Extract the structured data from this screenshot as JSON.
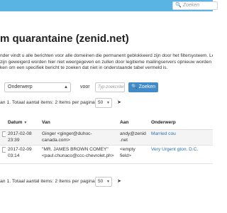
{
  "header": {
    "search_placeholder": "Zoeken",
    "search_icon": "search-icon"
  },
  "title": "m quarantaine (zenid.net)",
  "description": [
    "nder vindt u alle berichten voor alle domeinen die permanent geblokkeerd zijn door het filtersysteem. Let o",
    "zijn geweigerd worden hier niet weergegeven en zullen door legitieme mailingservers opnieuw worden aa",
    "ken om een specifiek bericht te zoeken dat niet in onderstaande tabel vermeld is."
  ],
  "filter": {
    "field_value": "Onderwerp",
    "voor_label": "voor",
    "search_placeholder": "Typ zoekcriteria in en",
    "search_button": "Zoeken"
  },
  "pagination": {
    "top_text": "an 1. Totaal aantal items: 2  Items per pagina:",
    "bottom_text": "an 1. Totaal aantal items: 2  Items per pagina:",
    "per_page": "50"
  },
  "table": {
    "columns": [
      "",
      "Datum",
      "Van",
      "Aan",
      "Onderwerp"
    ],
    "rows": [
      {
        "date": "2017-02-08 23:39",
        "from": "Ginger <ginger@duhoc-canada.com>",
        "to": "andy@zenid.net",
        "subject": "Married cou"
      },
      {
        "date": "2017-02-09 03:14",
        "from": "\"MR. JAMES BROWN COMEY\" <paul.chunaco@ccc-chevrolet.ph>",
        "to": "<empty field>",
        "subject": "Very Urgent gton. D.C."
      }
    ]
  }
}
